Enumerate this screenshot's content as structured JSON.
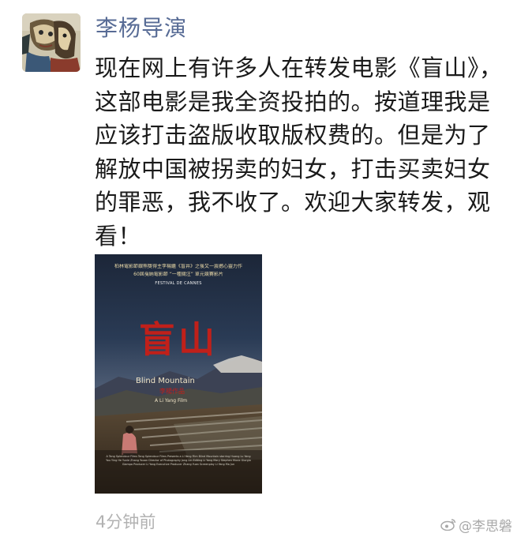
{
  "post": {
    "username": "李杨导演",
    "text": "现在网上有许多人在转发电影《盲山》，这部电影是我全资投拍的。按道理我是应该打击盗版收取版权费的。但是为了解放中国被拐卖的妇女，打击买卖妇女的罪恶，我不收了。欢迎大家转发，观看！",
    "timestamp": "4分钟前"
  },
  "poster": {
    "tagline_1": "柏林電影節銀熊獎得主李楊繼《盲井》之後又一震撼心靈力作",
    "tagline_2": "60屆戛納電影節 “一種關注” 單元競賽影片",
    "festival": "FESTIVAL DE CANNES",
    "title_cn": "盲山",
    "title_en": "Blind Mountain",
    "director_cn": "李楊作品",
    "director_en": "A Li Yang Film",
    "credits": "A Tang Splendour Films Tang Splendour Films Presents a Li Yang Film Blind Mountain starring Huang Lu Yang You Ying He Yunle Zhang Youan Director of Photography Jong Lin Editing Li Yang Mary Stephen Music Giorgio Giampa Producer Li Yang Executive Producer Zhang Yuan Screenplay Li Yang Ma Jun"
  },
  "watermark": {
    "icon": "weibo-icon",
    "text": "@李思磐"
  },
  "colors": {
    "username": "#576b95",
    "timestamp": "#b2b2b2",
    "poster_title": "#c0201a"
  }
}
